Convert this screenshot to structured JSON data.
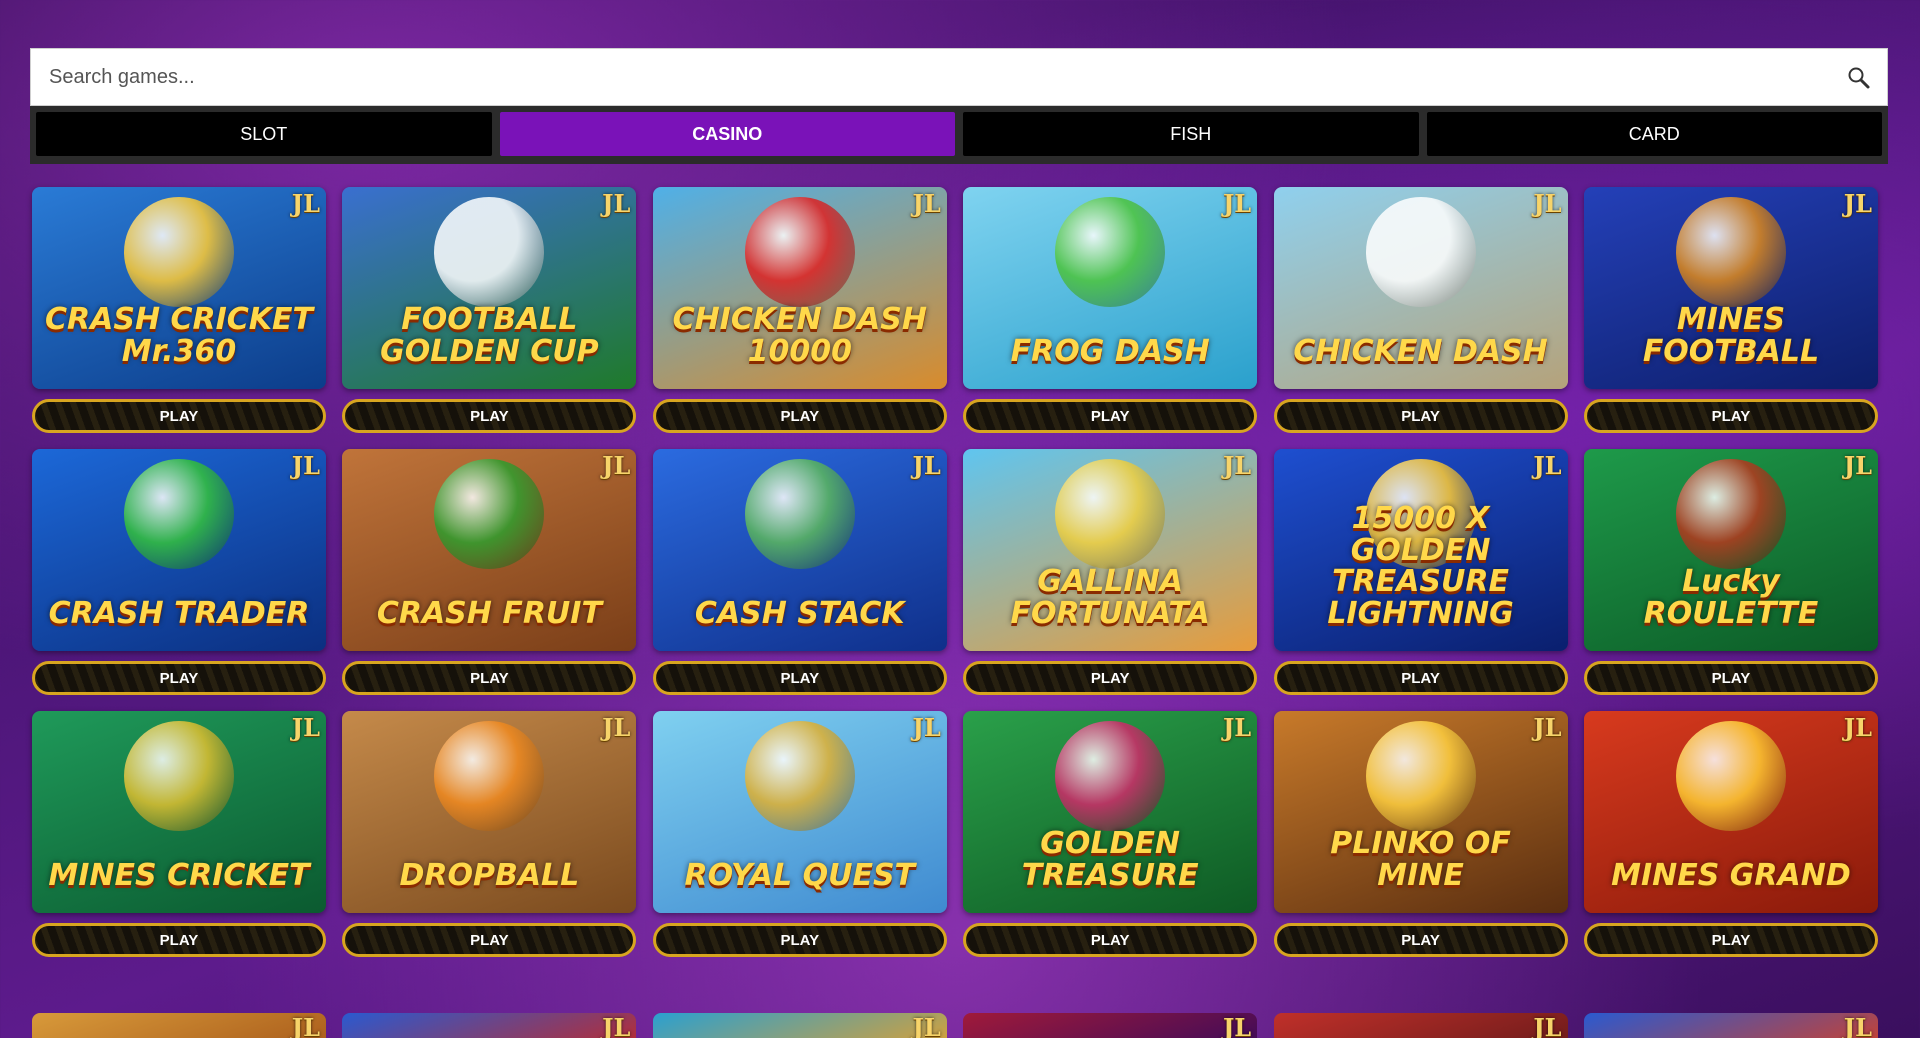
{
  "search": {
    "placeholder": "Search games...",
    "icon": "search-icon"
  },
  "categories": [
    {
      "label": "SLOT",
      "active": false
    },
    {
      "label": "CASINO",
      "active": true
    },
    {
      "label": "FISH",
      "active": false
    },
    {
      "label": "CARD",
      "active": false
    }
  ],
  "colors": {
    "active_tab": "#7a12b8",
    "play_border": "#d8a520",
    "badge": "#f7d46a"
  },
  "games": [
    {
      "title": "CRASH CRICKET Mr.360",
      "badge": "JL",
      "play_label": "PLAY",
      "bg": [
        "#2a7bd6",
        "#0c3d8a"
      ],
      "accent": "#ffcc33"
    },
    {
      "title": "FOOTBALL GOLDEN CUP",
      "badge": "JL",
      "play_label": "PLAY",
      "bg": [
        "#3a6fd0",
        "#1f7a2a"
      ],
      "accent": "#ffffff"
    },
    {
      "title": "CHICKEN DASH 10000",
      "badge": "JL",
      "play_label": "PLAY",
      "bg": [
        "#4fb0e8",
        "#d98b2b"
      ],
      "accent": "#e02020"
    },
    {
      "title": "FROG DASH",
      "badge": "JL",
      "play_label": "PLAY",
      "bg": [
        "#7fd3f0",
        "#2aa0cc"
      ],
      "accent": "#4cc43a"
    },
    {
      "title": "CHICKEN DASH",
      "badge": "JL",
      "play_label": "PLAY",
      "bg": [
        "#8fd0ee",
        "#b5a27a"
      ],
      "accent": "#ffffff"
    },
    {
      "title": "MINES FOOTBALL",
      "badge": "JL",
      "play_label": "PLAY",
      "bg": [
        "#2440b8",
        "#0d1e6a"
      ],
      "accent": "#e08a1a"
    },
    {
      "title": "CRASH TRADER",
      "badge": "JL",
      "play_label": "PLAY",
      "bg": [
        "#1c68d8",
        "#0b2f80"
      ],
      "accent": "#34c23a"
    },
    {
      "title": "CRASH FRUIT",
      "badge": "JL",
      "play_label": "PLAY",
      "bg": [
        "#c0743a",
        "#7a3e18"
      ],
      "accent": "#2e9e2e"
    },
    {
      "title": "CASH STACK",
      "badge": "JL",
      "play_label": "PLAY",
      "bg": [
        "#2b6be0",
        "#0f2f8a"
      ],
      "accent": "#5cb85c"
    },
    {
      "title": "GALLINA FORTUNATA",
      "badge": "JL",
      "play_label": "PLAY",
      "bg": [
        "#5fc5f0",
        "#e89b3a"
      ],
      "accent": "#f0d040"
    },
    {
      "title": "15000 X GOLDEN TREASURE LIGHTNING",
      "badge": "JL",
      "play_label": "PLAY",
      "bg": [
        "#1e4fd0",
        "#0a1f6e"
      ],
      "accent": "#ffcc33"
    },
    {
      "title": "Lucky ROULETTE",
      "badge": "JL",
      "play_label": "PLAY",
      "bg": [
        "#1e9a4a",
        "#0c5a26"
      ],
      "accent": "#b5381e"
    },
    {
      "title": "MINES CRICKET",
      "badge": "JL",
      "play_label": "PLAY",
      "bg": [
        "#1f9a5a",
        "#0b5a30"
      ],
      "accent": "#e0c030"
    },
    {
      "title": "DROPBALL",
      "badge": "JL",
      "play_label": "PLAY",
      "bg": [
        "#c58a4a",
        "#7a4a1e"
      ],
      "accent": "#f08a20"
    },
    {
      "title": "ROYAL QUEST",
      "badge": "JL",
      "play_label": "PLAY",
      "bg": [
        "#7fd0f0",
        "#3f8ad0"
      ],
      "accent": "#e0b030"
    },
    {
      "title": "GOLDEN TREASURE",
      "badge": "JL",
      "play_label": "PLAY",
      "bg": [
        "#2aa04a",
        "#0e5a24"
      ],
      "accent": "#d02a6a"
    },
    {
      "title": "PLINKO OF MINE",
      "badge": "JL",
      "play_label": "PLAY",
      "bg": [
        "#c87a2a",
        "#5a2e10"
      ],
      "accent": "#ffd040"
    },
    {
      "title": "MINES GRAND",
      "badge": "JL",
      "play_label": "PLAY",
      "bg": [
        "#d83a1e",
        "#8a1a0a"
      ],
      "accent": "#ffcc33"
    }
  ],
  "partial_games": [
    {
      "badge": "JL",
      "bg": [
        "#d89a3a",
        "#a85a1a"
      ]
    },
    {
      "badge": "JL",
      "bg": [
        "#2a5ad0",
        "#c02a2a"
      ]
    },
    {
      "badge": "JL",
      "bg": [
        "#2aa0d0",
        "#e0a030"
      ]
    },
    {
      "badge": "JL",
      "bg": [
        "#a01a3a",
        "#3a0a5a"
      ]
    },
    {
      "badge": "JL",
      "bg": [
        "#c0302a",
        "#6a1a1a"
      ]
    },
    {
      "badge": "JL",
      "bg": [
        "#2a5ad0",
        "#d0402a"
      ]
    }
  ]
}
